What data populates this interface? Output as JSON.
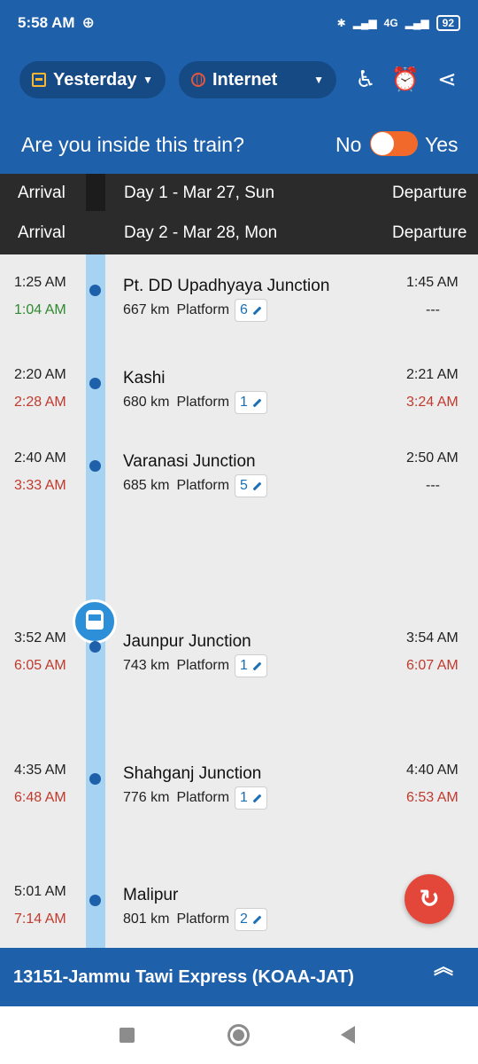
{
  "status": {
    "time": "5:58 AM",
    "network": "4G",
    "battery": "92"
  },
  "header": {
    "date_label": "Yesterday",
    "source_label": "Internet",
    "inside_question": "Are you inside this train?",
    "toggle_no": "No",
    "toggle_yes": "Yes",
    "icons": [
      "wheelchair-icon",
      "alarm-icon",
      "share-icon"
    ]
  },
  "days": [
    {
      "arrival_label": "Arrival",
      "day_label": "Day 1 - Mar 27, Sun",
      "departure_label": "Departure"
    },
    {
      "arrival_label": "Arrival",
      "day_label": "Day 2 - Mar 28, Mon",
      "departure_label": "Departure"
    }
  ],
  "stations": [
    {
      "name": "Pt. DD Upadhyaya Junction",
      "arr_sched": "1:25 AM",
      "arr_actual": "1:04 AM",
      "dep_sched": "1:45 AM",
      "dep_actual": "---",
      "km": "667 km",
      "platform_label": "Platform",
      "platform": "6"
    },
    {
      "name": "Kashi",
      "arr_sched": "2:20 AM",
      "arr_actual": "2:28 AM",
      "dep_sched": "2:21 AM",
      "dep_actual": "3:24 AM",
      "km": "680 km",
      "platform_label": "Platform",
      "platform": "1"
    },
    {
      "name": "Varanasi Junction",
      "arr_sched": "2:40 AM",
      "arr_actual": "3:33 AM",
      "dep_sched": "2:50 AM",
      "dep_actual": "---",
      "km": "685 km",
      "platform_label": "Platform",
      "platform": "5"
    },
    {
      "name": "Jaunpur Junction",
      "arr_sched": "3:52 AM",
      "arr_actual": "6:05 AM",
      "dep_sched": "3:54 AM",
      "dep_actual": "6:07 AM",
      "km": "743 km",
      "platform_label": "Platform",
      "platform": "1"
    },
    {
      "name": "Shahganj Junction",
      "arr_sched": "4:35 AM",
      "arr_actual": "6:48 AM",
      "dep_sched": "4:40 AM",
      "dep_actual": "6:53 AM",
      "km": "776 km",
      "platform_label": "Platform",
      "platform": "1"
    },
    {
      "name": "Malipur",
      "arr_sched": "5:01 AM",
      "arr_actual": "7:14 AM",
      "dep_sched": "",
      "dep_actual": "",
      "km": "801 km",
      "platform_label": "Platform",
      "platform": "2"
    }
  ],
  "colors": {
    "primary": "#1f60aa",
    "on_time": "#2f8a2f",
    "late": "#c03a2e",
    "toggle": "#f26a2b",
    "fab": "#e3473a"
  },
  "footer": {
    "train_title": "13151-Jammu Tawi Express (KOAA-JAT)"
  }
}
